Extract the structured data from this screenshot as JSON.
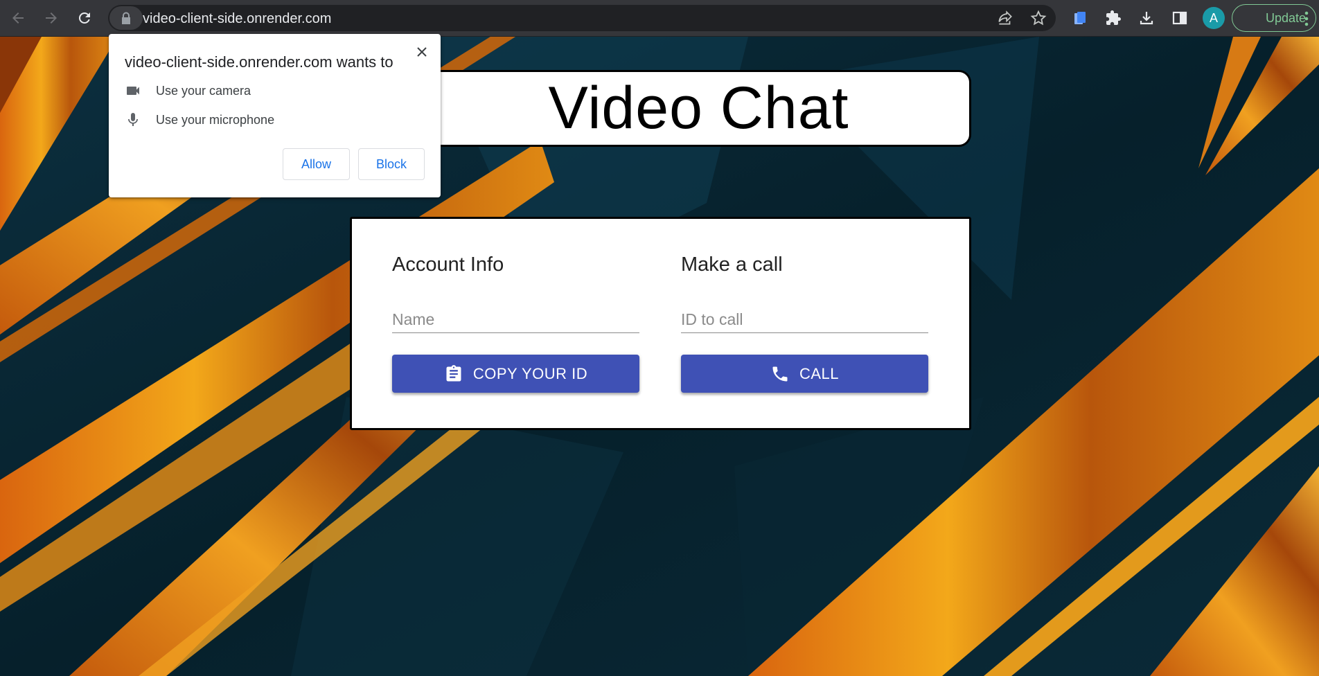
{
  "browser": {
    "url": "video-client-side.onrender.com",
    "profile_initial": "A",
    "update_label": "Update",
    "accent_update": "#81c995"
  },
  "permission_prompt": {
    "title": "video-client-side.onrender.com wants to",
    "items": [
      {
        "icon": "camera-icon",
        "label": "Use your camera"
      },
      {
        "icon": "microphone-icon",
        "label": "Use your microphone"
      }
    ],
    "allow_label": "Allow",
    "block_label": "Block"
  },
  "page": {
    "title": "Video Chat",
    "account": {
      "heading": "Account Info",
      "name_placeholder": "Name",
      "copy_button_label": "COPY YOUR ID"
    },
    "call": {
      "heading": "Make a call",
      "id_placeholder": "ID to call",
      "call_button_label": "CALL"
    },
    "button_color": "#3f51b5"
  }
}
